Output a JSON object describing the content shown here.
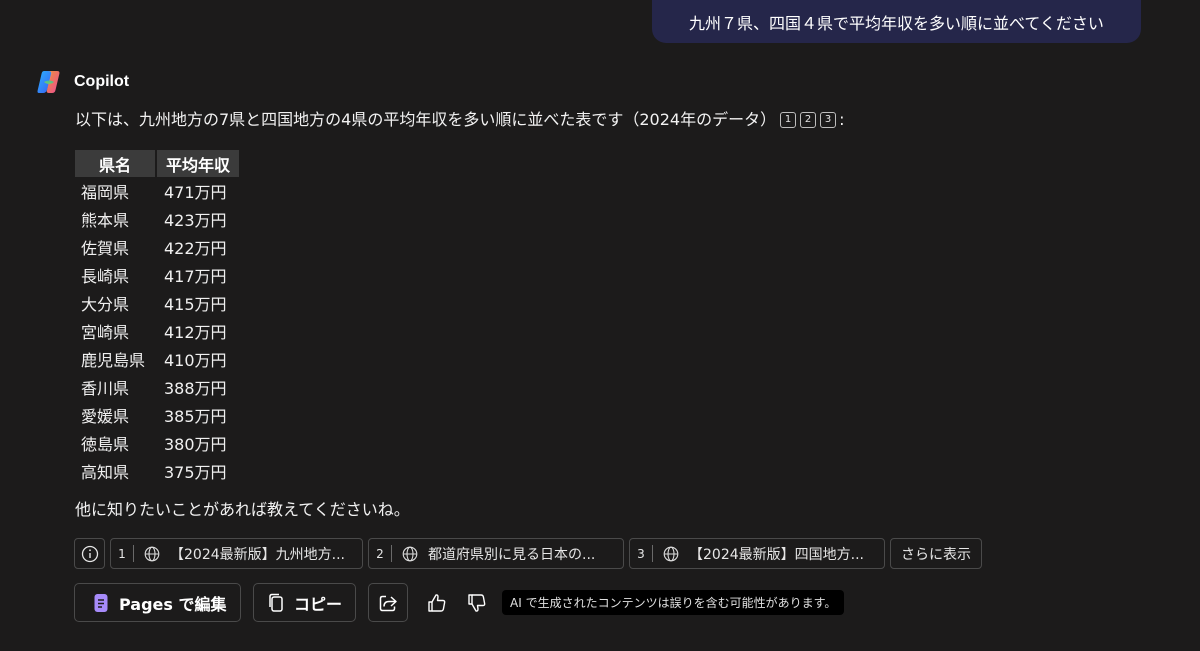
{
  "user_message": "九州７県、四国４県で平均年収を多い順に並べてください",
  "assistant": {
    "name": "Copilot",
    "intro": "以下は、九州地方の7県と四国地方の4県の平均年収を多い順に並べた表です（2024年のデータ）",
    "intro_citations": [
      "1",
      "2",
      "3"
    ],
    "intro_end": ":",
    "table": {
      "headers": [
        "県名",
        "平均年収"
      ],
      "rows": [
        [
          "福岡県",
          "471万円"
        ],
        [
          "熊本県",
          "423万円"
        ],
        [
          "佐賀県",
          "422万円"
        ],
        [
          "長崎県",
          "417万円"
        ],
        [
          "大分県",
          "415万円"
        ],
        [
          "宮崎県",
          "412万円"
        ],
        [
          "鹿児島県",
          "410万円"
        ],
        [
          "香川県",
          "388万円"
        ],
        [
          "愛媛県",
          "385万円"
        ],
        [
          "徳島県",
          "380万円"
        ],
        [
          "高知県",
          "375万円"
        ]
      ]
    },
    "outro": "他に知りたいことがあれば教えてくださいね。"
  },
  "sources": [
    {
      "num": "1",
      "title": "【2024最新版】九州地方..."
    },
    {
      "num": "2",
      "title": "都道府県別に見る日本の..."
    },
    {
      "num": "3",
      "title": "【2024最新版】四国地方..."
    }
  ],
  "sources_more": "さらに表示",
  "actions": {
    "pages_label": "Pages で編集",
    "copy_label": "コピー"
  },
  "disclaimer": "AI で生成されたコンテンツは誤りを含む可能性があります。",
  "colors": {
    "background": "#1c1b1b",
    "user_bubble": "#25264a",
    "pages_icon": "#a78bfa",
    "table_header": "#3b3b3b"
  }
}
